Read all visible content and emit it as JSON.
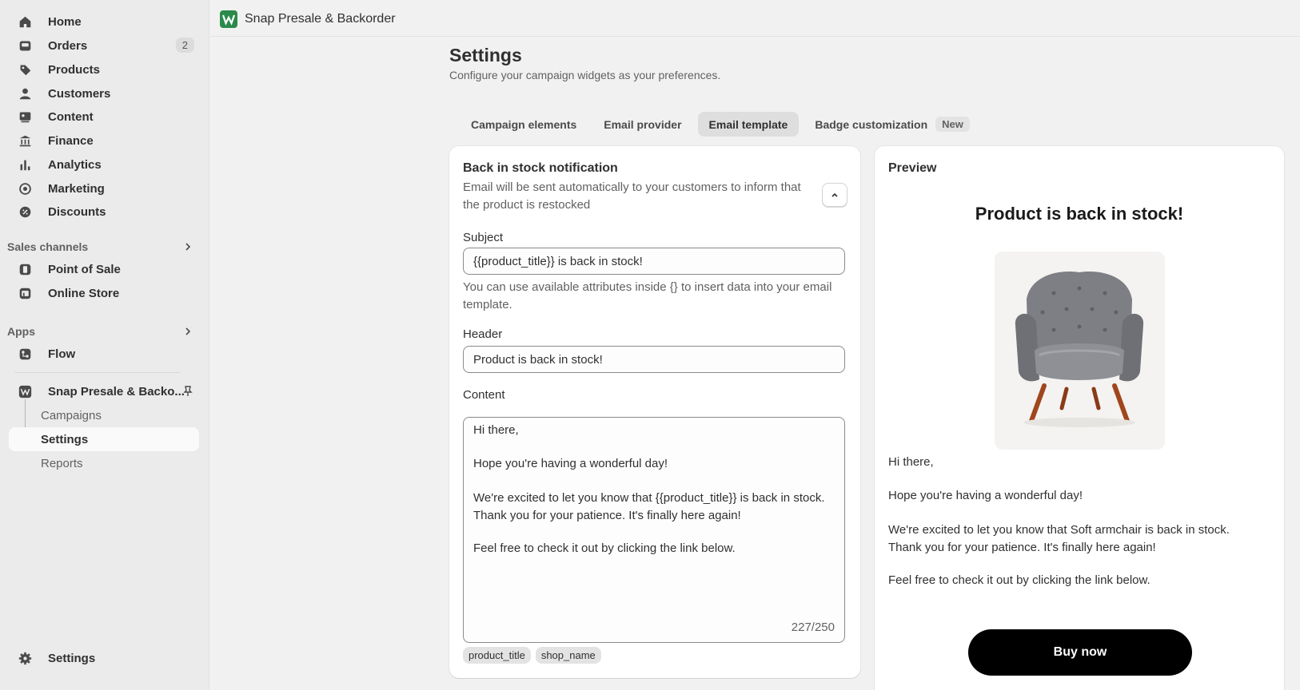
{
  "sidebar": {
    "items": [
      {
        "label": "Home",
        "icon": "home-icon"
      },
      {
        "label": "Orders",
        "icon": "inbox-icon",
        "badge": "2"
      },
      {
        "label": "Products",
        "icon": "tag-icon"
      },
      {
        "label": "Customers",
        "icon": "person-icon"
      },
      {
        "label": "Content",
        "icon": "image-icon"
      },
      {
        "label": "Finance",
        "icon": "bank-icon"
      },
      {
        "label": "Analytics",
        "icon": "bar-chart-icon"
      },
      {
        "label": "Marketing",
        "icon": "target-icon"
      },
      {
        "label": "Discounts",
        "icon": "discount-icon"
      }
    ],
    "sales_channels": {
      "title": "Sales channels",
      "items": [
        {
          "label": "Point of Sale",
          "icon": "pos-icon"
        },
        {
          "label": "Online Store",
          "icon": "store-icon"
        }
      ]
    },
    "apps": {
      "title": "Apps",
      "items": [
        {
          "label": "Flow",
          "icon": "flow-icon"
        }
      ]
    },
    "app": {
      "name": "Snap Presale & Backo...",
      "sub_items": [
        {
          "label": "Campaigns"
        },
        {
          "label": "Settings"
        },
        {
          "label": "Reports"
        }
      ]
    },
    "settings_label": "Settings"
  },
  "topbar": {
    "app_name": "Snap Presale & Backorder"
  },
  "page": {
    "title": "Settings",
    "subtitle": "Configure your campaign widgets as your preferences."
  },
  "tabs": [
    {
      "label": "Campaign elements"
    },
    {
      "label": "Email provider"
    },
    {
      "label": "Email template",
      "active": true
    },
    {
      "label": "Badge customization",
      "badge": "New"
    }
  ],
  "form": {
    "title": "Back in stock notification",
    "description": "Email will be sent automatically to your customers to inform that the product is restocked",
    "subject_label": "Subject",
    "subject_value": "{{product_title}} is back in stock!",
    "subject_help": "You can use available attributes inside {} to insert data into your email template.",
    "header_label": "Header",
    "header_value": "Product is back in stock!",
    "content_label": "Content",
    "content_lines": [
      "Hi there,",
      "Hope you're having a wonderful day!",
      "We're excited to let you know that {{product_title}} is back in stock. Thank you for your patience. It's finally here again!",
      "Feel free to check it out by clicking the link below."
    ],
    "char_count": "227/250",
    "attributes": [
      "product_title",
      "shop_name"
    ]
  },
  "preview": {
    "title": "Preview",
    "heading": "Product is back in stock!",
    "lines": [
      "Hi there,",
      "Hope you're having a wonderful day!",
      "We're excited to let you know that Soft armchair is back in stock. Thank you for your patience. It's finally here again!",
      "Feel free to check it out by clicking the link below."
    ],
    "button_label": "Buy now"
  },
  "colors": {
    "app_logo": "#2a8a4a",
    "button_bg": "#000000",
    "sidebar_bg": "#ebebeb",
    "page_bg": "#f1f1f1"
  }
}
